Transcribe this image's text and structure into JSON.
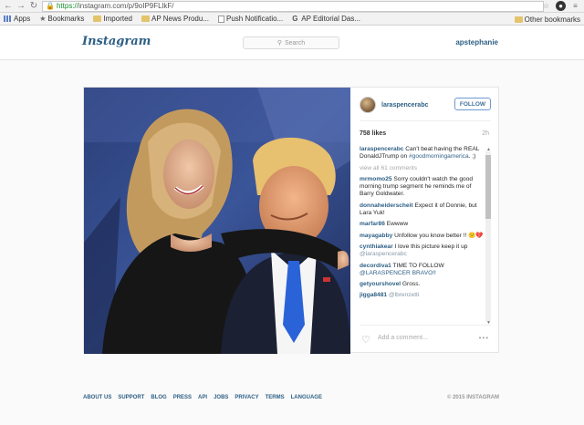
{
  "browser": {
    "url_scheme": "https://",
    "url_rest": "instagram.com/p/9oIP9FLlkF/",
    "bookmarks": [
      {
        "label": "Apps",
        "icon": "apps-icon"
      },
      {
        "label": "Bookmarks",
        "icon": "star-icon"
      },
      {
        "label": "Imported",
        "icon": "folder-icon"
      },
      {
        "label": "AP News Produ...",
        "icon": "folder-icon"
      },
      {
        "label": "Push Notificatio...",
        "icon": "page-icon"
      },
      {
        "label": "AP Editorial Das...",
        "icon": "google-icon"
      }
    ],
    "other_bookmarks": "Other bookmarks"
  },
  "header": {
    "logo": "Instagram",
    "search_placeholder": "Search",
    "username": "apstephanie"
  },
  "post": {
    "author": "laraspencerabc",
    "follow_label": "FOLLOW",
    "likes": "758 likes",
    "age": "2h",
    "caption": {
      "user": "laraspencerabc",
      "text": "Can't beat having the REAL DonaldJTrump on",
      "hashtag": "#goodmorningamerica",
      "suffix": ". ;)"
    },
    "view_all": "view all 61 comments",
    "comments": [
      {
        "user": "mrmomo25",
        "text": "Sorry couldn't watch the good morning trump segment he reminds me of Barry Goldwater.",
        "tag": ""
      },
      {
        "user": "donnaheiderscheit",
        "text": "Expect it of Donnie, but Lara Yuk!",
        "tag": ""
      },
      {
        "user": "marfar86",
        "text": "Ewwww",
        "tag": ""
      },
      {
        "user": "mayagabby",
        "text": "Unfollow you know better !! 😕💔",
        "tag": ""
      },
      {
        "user": "cynthiakear",
        "text": "I love this picture keep it up",
        "tag": "@laraspencerabc"
      },
      {
        "user": "decordiva1",
        "text": "TIME TO FOLLOW",
        "tag": "@LARASPENCER BRAVO!!"
      },
      {
        "user": "getyourshovel",
        "text": "Gross.",
        "tag": ""
      },
      {
        "user": "jigga8481",
        "text": "",
        "tag": "@lbrenzetti"
      }
    ],
    "add_comment_placeholder": "Add a comment...",
    "more": "•••"
  },
  "footer": {
    "links": [
      "ABOUT US",
      "SUPPORT",
      "BLOG",
      "PRESS",
      "API",
      "JOBS",
      "PRIVACY",
      "TERMS",
      "LANGUAGE"
    ],
    "copyright": "© 2015 INSTAGRAM"
  }
}
